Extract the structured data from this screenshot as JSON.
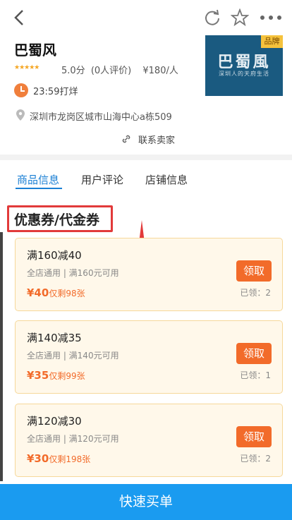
{
  "shop": {
    "name": "巴蜀风",
    "stars": "★★★★★",
    "score": "5.0分",
    "reviews": "(0人评价)",
    "price": "¥180/人",
    "hours": "23:59打烊",
    "address": "深圳市龙岗区城市山海中心a栋509",
    "contact": "联系卖家",
    "logo_text": "巴蜀風",
    "logo_sub": "深圳人的天府生活",
    "logo_badge": "品牌"
  },
  "tabs": [
    {
      "label": "商品信息",
      "active": true
    },
    {
      "label": "用户评论",
      "active": false
    },
    {
      "label": "店铺信息",
      "active": false
    }
  ],
  "section_title": "优惠券/代金券",
  "coupons": [
    {
      "title": "满160减40",
      "desc": "全店通用 | 满160元可用",
      "price": "¥40",
      "remain": "仅剩98张",
      "btn": "领取",
      "claimed": "已领：2"
    },
    {
      "title": "满140减35",
      "desc": "全店通用 | 满140元可用",
      "price": "¥35",
      "remain": "仅剩99张",
      "btn": "领取",
      "claimed": "已领：1"
    },
    {
      "title": "满120减30",
      "desc": "全店通用 | 满120元可用",
      "price": "¥30",
      "remain": "仅剩198张",
      "btn": "领取",
      "claimed": "已领：2"
    }
  ],
  "bottom_button": "快速买单",
  "colors": {
    "accent": "#1a9bf0",
    "orange": "#f26b2a",
    "highlight": "#e23a3a"
  }
}
